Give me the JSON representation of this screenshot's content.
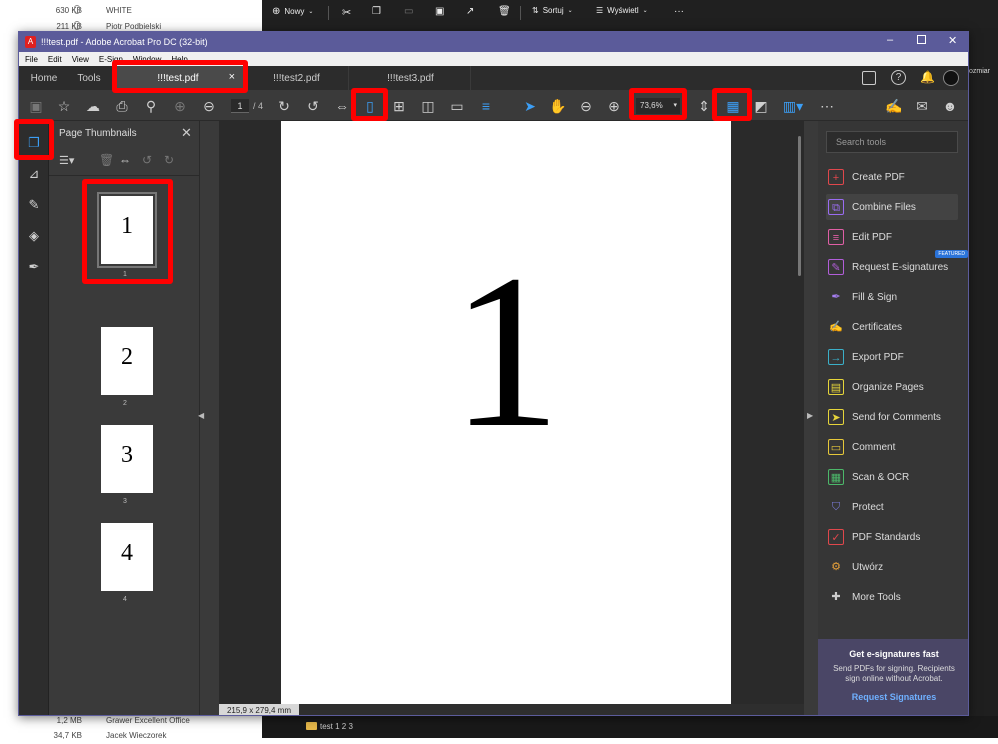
{
  "explorer": {
    "rows_top": [
      {
        "size": "630 KB",
        "name": "WHITE"
      },
      {
        "size": "211 KB",
        "name": "Piotr Podbielski"
      }
    ],
    "rows_bottom": [
      {
        "size": "1,2 MB",
        "name": "Grawer Excellent Office"
      },
      {
        "size": "34,7 KB",
        "name": "Jacek Wieczorek"
      }
    ],
    "toolbar": {
      "new_label": "Nowy",
      "sort_label": "Sortuj",
      "view_label": "Wyświetl",
      "more": "···"
    },
    "folder_label": "test 1 2 3",
    "right_fragment": "ozmiar"
  },
  "window": {
    "title": "!!!test.pdf - Adobe Acrobat Pro DC (32-bit)",
    "menu": [
      "File",
      "Edit",
      "View",
      "E-Sign",
      "Window",
      "Help"
    ],
    "tabs": {
      "home": "Home",
      "tools": "Tools",
      "doc1": "!!!test.pdf",
      "doc2": "!!!test2.pdf",
      "doc3": "!!!test3.pdf",
      "close": "×"
    },
    "toolbar": {
      "page_current": "1",
      "page_total": "/ 4",
      "zoom": "73,6%"
    },
    "thumbnails": {
      "title": "Page Thumbnails",
      "pages": [
        {
          "label": "1",
          "caption": "1"
        },
        {
          "label": "2",
          "caption": "2"
        },
        {
          "label": "3",
          "caption": "3"
        },
        {
          "label": "4",
          "caption": "4"
        }
      ]
    },
    "document": {
      "page_number_display": "1",
      "page_size": "215,9 x 279,4 mm"
    },
    "tools": {
      "search_placeholder": "Search tools",
      "items": [
        {
          "label": "Create PDF",
          "color": "#e0474c"
        },
        {
          "label": "Combine Files",
          "color": "#9b6cf2"
        },
        {
          "label": "Edit PDF",
          "color": "#e05fa6"
        },
        {
          "label": "Request E-signatures",
          "color": "#b25ed9",
          "badge": "FEATURED"
        },
        {
          "label": "Fill & Sign",
          "color": "#a67ef2"
        },
        {
          "label": "Certificates",
          "color": "#5c9ad6"
        },
        {
          "label": "Export PDF",
          "color": "#3bb0c9"
        },
        {
          "label": "Organize Pages",
          "color": "#e6d53a"
        },
        {
          "label": "Send for Comments",
          "color": "#e6d53a"
        },
        {
          "label": "Comment",
          "color": "#e6c83a"
        },
        {
          "label": "Scan & OCR",
          "color": "#4cb86a"
        },
        {
          "label": "Protect",
          "color": "#7b7bd8"
        },
        {
          "label": "PDF Standards",
          "color": "#e0474c"
        },
        {
          "label": "Utwórz",
          "color": "#e8a13a"
        },
        {
          "label": "More Tools",
          "color": "#cccccc"
        }
      ],
      "promo": {
        "title": "Get e-signatures fast",
        "body": "Send PDFs for signing. Recipients sign online without Acrobat.",
        "link": "Request Signatures"
      }
    }
  }
}
